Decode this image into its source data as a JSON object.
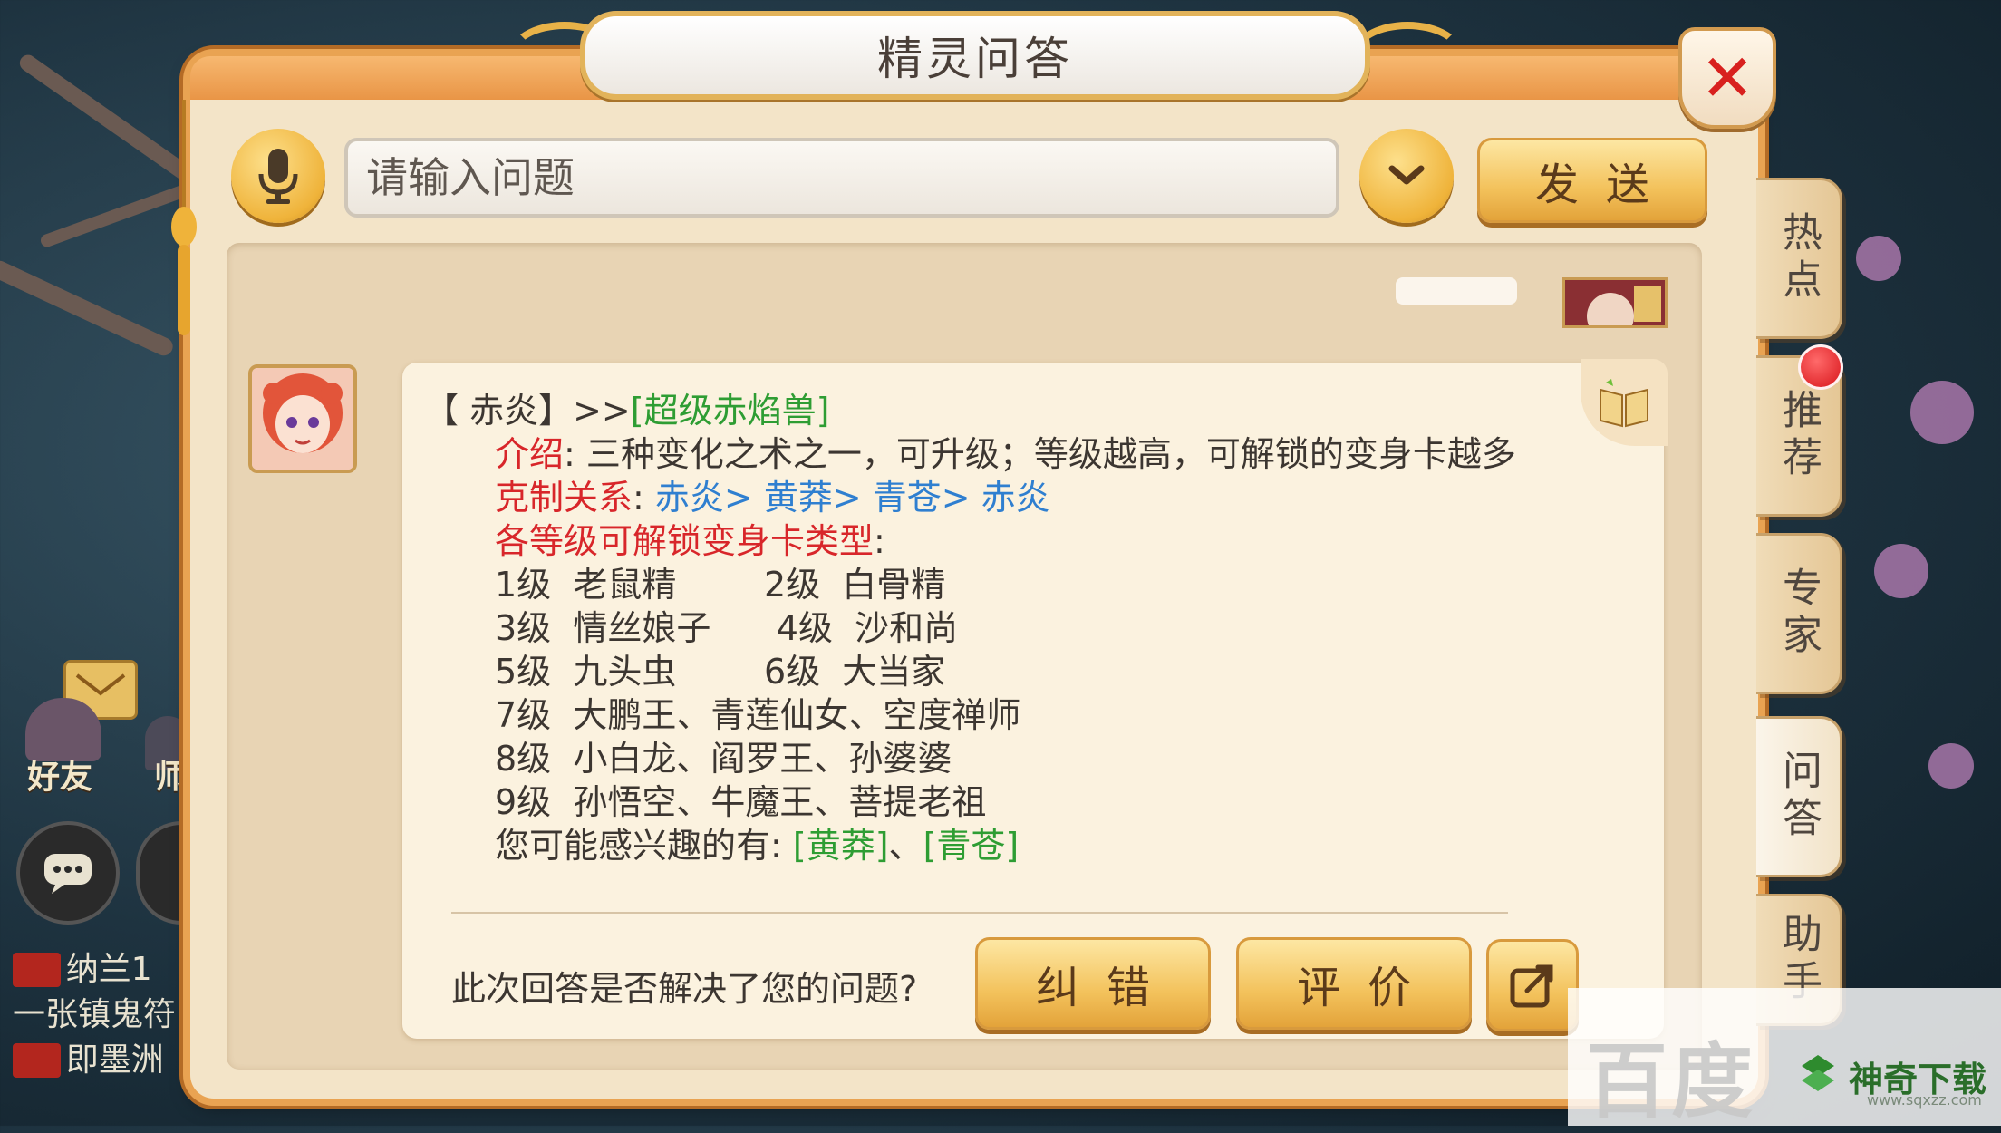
{
  "dialog": {
    "title": "精灵问答",
    "close_icon": "close-x-icon"
  },
  "search": {
    "placeholder": "请输入问题",
    "value": "",
    "send_label": "发送"
  },
  "answer": {
    "header_prefix": "【 赤炎】>>",
    "header_link": "[超级赤焰兽]",
    "intro_label": "介绍",
    "intro_text": ": 三种变化之术之一，可升级；等级越高，可解锁的变身卡越多",
    "restraint_label": "克制关系",
    "restraint_colon": ": ",
    "restraint_chain": "赤炎> 黄莽> 青苍> 赤炎",
    "card_types_label": "各等级可解锁变身卡类型",
    "card_types_colon": ":",
    "levels": [
      "1级  老鼠精        2级  白骨精",
      "3级  情丝娘子      4级  沙和尚",
      "5级  九头虫        6级  大当家",
      "7级  大鹏王、青莲仙女、空度禅师",
      "8级  小白龙、阎罗王、孙婆婆",
      "9级  孙悟空、牛魔王、菩提老祖"
    ],
    "interest_prefix": "您可能感兴趣的有: ",
    "interest_link_1": "[黄莽]",
    "interest_sep": "、",
    "interest_link_2": "[青苍]"
  },
  "feedback": {
    "question": "此次回答是否解决了您的问题?",
    "correct_label": "纠错",
    "rate_label": "评价"
  },
  "side_tabs": [
    {
      "label": "热点",
      "active": false
    },
    {
      "label": "推荐",
      "active": false,
      "badge": true
    },
    {
      "label": "专家",
      "active": false
    },
    {
      "label": "问答",
      "active": true
    },
    {
      "label": "助手",
      "active": false
    }
  ],
  "hud": {
    "friends_label": "好友",
    "master_label": "师",
    "chat_lines": [
      {
        "tag": "",
        "text": "纳兰1"
      },
      {
        "tag": "",
        "text": "一张镇鬼符"
      },
      {
        "tag": "",
        "text": "即墨洲"
      }
    ]
  },
  "watermark": {
    "baidu": "百度",
    "brand": "神奇下载",
    "url": "www.sqxzz.com"
  },
  "colors": {
    "accent_gold": "#f3c25c",
    "frame_orange": "#e9a352",
    "keyword_red": "#d8262a",
    "link_blue": "#2f7fd0",
    "link_green": "#2e9d33"
  }
}
